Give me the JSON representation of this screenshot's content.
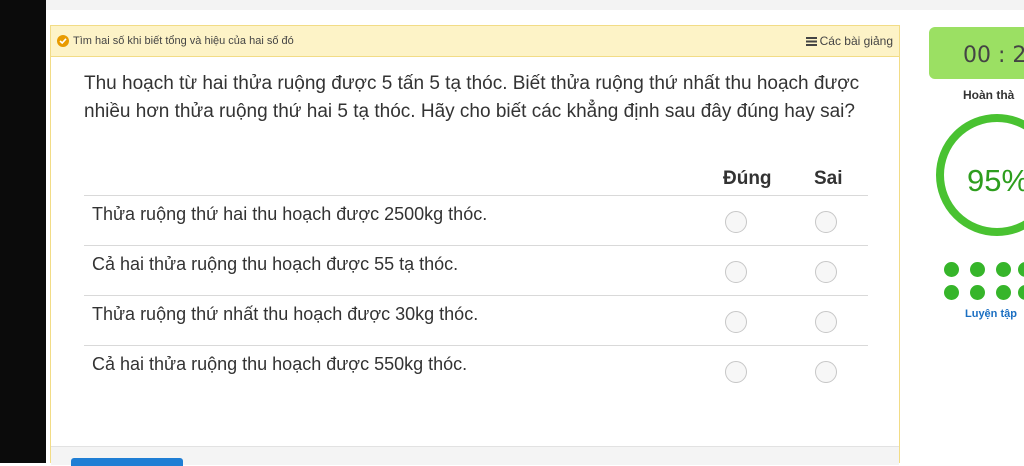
{
  "header": {
    "topic": "Tìm hai số khi biết tổng và hiệu của hai số đó",
    "lessons_link": "Các bài giảng"
  },
  "question": {
    "text": "Thu hoạch từ hai thửa ruộng được 5 tấn 5 tạ thóc. Biết thửa ruộng thứ nhất thu hoạch được nhiều hơn thửa ruộng thứ hai 5 tạ thóc. Hãy cho biết các khẳng định sau đây đúng hay sai?",
    "col_true": "Đúng",
    "col_false": "Sai",
    "statements": [
      "Thửa ruộng thứ hai thu hoạch được 2500kg thóc.",
      "Cả hai thửa ruộng thu hoạch được 55 tạ thóc.",
      "Thửa ruộng thứ nhất thu hoạch được 30kg thóc.",
      "Cả hai thửa ruộng thu hoạch được 550kg thóc."
    ]
  },
  "sidebar": {
    "timer": "00 : 2",
    "completion_label": "Hoàn thà",
    "progress_percent": "95%",
    "progress_value": 95,
    "practice_label": "Luyện tập"
  },
  "colors": {
    "accent_green": "#49c231",
    "header_bg": "#fdf3c7",
    "timer_bg": "#9be063",
    "link_blue": "#1b6fc2"
  }
}
